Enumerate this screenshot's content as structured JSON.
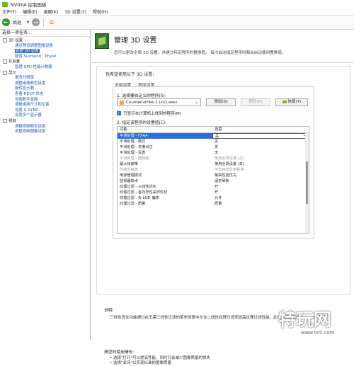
{
  "window": {
    "title": "NVIDIA 控制面板"
  },
  "menu": [
    "文件(F)",
    "编辑(E)",
    "桌面(K)",
    "3D 设置(3)",
    "帮助(H)"
  ],
  "toolbar": {
    "back_label": "后退",
    "forward_arrow": "▾"
  },
  "left_pane": {
    "title": "选择一项任务...",
    "tree": [
      {
        "label": "3D 设置",
        "type": "cat"
      },
      {
        "label": "通过预览调整图像设置",
        "type": "child"
      },
      {
        "label": "管理 3D 设置",
        "type": "child",
        "selected": true
      },
      {
        "label": "配置 Surround、PhysX",
        "type": "child"
      },
      {
        "label": "开发者",
        "type": "cat"
      },
      {
        "label": "管理 GPU 性能计数器",
        "type": "child"
      },
      {
        "label": "显示",
        "type": "cat"
      },
      {
        "label": "更改分辨率",
        "type": "child"
      },
      {
        "label": "调整桌面颜色设置",
        "type": "child"
      },
      {
        "label": "旋转显示器",
        "type": "child"
      },
      {
        "label": "查看 HDCP 状态",
        "type": "child"
      },
      {
        "label": "设置数字音频",
        "type": "child"
      },
      {
        "label": "调整桌面尺寸和位置",
        "type": "child"
      },
      {
        "label": "设置 G-SYNC",
        "type": "child"
      },
      {
        "label": "设置多个显示器",
        "type": "child"
      },
      {
        "label": "视频",
        "type": "cat"
      },
      {
        "label": "调整视频颜色设置",
        "type": "child"
      },
      {
        "label": "调整视频图像设置",
        "type": "child"
      }
    ]
  },
  "main": {
    "heading": "管理 3D 设置",
    "description": "您可以更改全局 3D 设置，并建立特定程序的置换值。 每次启动指定程序时都会自动使用置换值。",
    "panel_title": "我希望使用以下 3D 设置：",
    "tabs": [
      "全局设置",
      "程序设置"
    ],
    "step1": "1. 选择要自定义的程序(S):",
    "program": "Counter-strike 2 (cs2.exe)",
    "buttons": {
      "add": "添加(D)",
      "remove": "删除(R)",
      "restore": "恢复(T)"
    },
    "checkbox_label": "只显示本计算机上找到的程序(M)",
    "step2": "2. 指定该程序的设置值(C):",
    "col_feature": "功能",
    "col_setting": "设置",
    "rows": [
      {
        "f": "平滑处理 - FXAA",
        "v": "关",
        "sel": true
      },
      {
        "f": "平滑处理 - 模式",
        "v": "关"
      },
      {
        "f": "平滑处理 - 灰度纠正",
        "v": "关"
      },
      {
        "f": "平滑处理 - 设置",
        "v": "无"
      },
      {
        "f": "平滑处理 - 透明度",
        "v": "使用全局设置 (关)",
        "dim": true
      },
      {
        "f": "最大帧速率",
        "v": "使用全局设置 (关)"
      },
      {
        "f": "环境光吸收",
        "v": "不支持此应用程序",
        "dim": true
      },
      {
        "f": "电源管理模式",
        "v": "最高性能优先"
      },
      {
        "f": "监视器技术",
        "v": "固定刷新"
      },
      {
        "f": "纹理过滤 - 三线性优化",
        "v": "开"
      },
      {
        "f": "纹理过滤 - 各向异性采样优化",
        "v": "开"
      },
      {
        "f": "纹理过滤 - 负 LOD 偏移",
        "v": "允许"
      },
      {
        "f": "纹理过滤 - 质量",
        "v": "质量"
      }
    ],
    "explain_heading": "说明:",
    "explain_text": "三线性优化功能通过在无需三线性过滤的某些场景中允许二线性纹理过滤来提高纹理过滤性能。此设置只会影响 DirectX 程序。",
    "usage_heading": "典型的使用情形:",
    "usage": [
      "选择\"打开\"可以提高性能，同时只会减少图像质量的损失",
      "选择\"关闭\"以实现标准的图像质量"
    ]
  },
  "watermark": {
    "title": "特玩网",
    "url": "www.te5.com"
  },
  "colors": {
    "accent": "#2f6fd6",
    "nvidia_green": "#76b900",
    "toolbar_green": "#2e9a2e"
  }
}
